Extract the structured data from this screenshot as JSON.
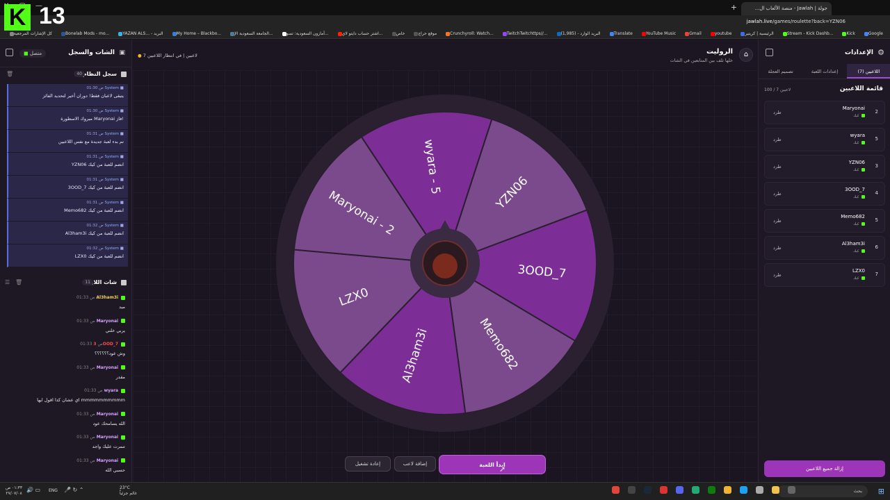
{
  "overlay": {
    "logo_letter": "K",
    "logo_number": "13"
  },
  "browser": {
    "tab_title": "جولة | Jawlah - منصة الألعاب ال...",
    "url_host": "jawlah.live",
    "url_path": "/games/roulette?back=YZN06",
    "bookmarks": [
      {
        "label": "Google",
        "color": "#4285f4"
      },
      {
        "label": "Kick",
        "color": "#53fc18"
      },
      {
        "label": "Stream - Kick Dashb...",
        "color": "#53fc18"
      },
      {
        "label": "الرئيسية | كريتير",
        "color": "#3a6ee8"
      },
      {
        "label": "youtube",
        "color": "#ff0000"
      },
      {
        "label": "Gmail",
        "color": "#ea4335"
      },
      {
        "label": "YouTube Music",
        "color": "#ff0000"
      },
      {
        "label": "Translate",
        "color": "#4285f4"
      },
      {
        "label": "البريد الوارد - (1,985)",
        "color": "#0f6cbd"
      },
      {
        "label": "TwitchTwitchttps//...",
        "color": "#9146ff"
      },
      {
        "label": "Crunchyroll: Watch...",
        "color": "#f47521"
      },
      {
        "label": "موقع حراج",
        "color": "#555555"
      },
      {
        "label": "خاص",
        "color": "#555555"
      },
      {
        "label": "اشتر حساب دايتو لاي...",
        "color": "#ff2200"
      },
      {
        "label": "أمازون السعودية: تسو...",
        "color": "#ffffff"
      },
      {
        "label": "الجامعة السعودية الإ...",
        "color": "#4a7d9e"
      },
      {
        "label": "My Home – Blackbo...",
        "color": "#3a7fd5"
      },
      {
        "label": "YAZAN ALS... - البريد",
        "color": "#3ab0e8"
      },
      {
        "label": "Bonelab Mods - mo...",
        "color": "#2a5599"
      },
      {
        "label": "كل الإشارات المرجعية",
        "color": "#888888"
      }
    ]
  },
  "left_panel": {
    "title": "الشات والسجل",
    "status": "متصل",
    "system_log": {
      "title": "سجل النظام",
      "count": "40",
      "items": [
        {
          "who": "System",
          "time": "01:30 ص",
          "text": "يتبقى لاعبان فقط! دوران أخير لتحديد الفائز"
        },
        {
          "who": "System",
          "time": "01:30 ص",
          "text": "مبروك الاسطورة Maryonai فاز!"
        },
        {
          "who": "System",
          "time": "01:31 ص",
          "text": "تم بدء لعبة جديدة مع نفس اللاعبين"
        },
        {
          "who": "System",
          "time": "01:31 ص",
          "text": "YZN06 انضم للعبة من كيك"
        },
        {
          "who": "System",
          "time": "01:31 ص",
          "text": "3OOD_7 انضم للعبة من كيك"
        },
        {
          "who": "System",
          "time": "01:31 ص",
          "text": "Memo682 انضم للعبة من كيك"
        },
        {
          "who": "System",
          "time": "01:32 ص",
          "text": "Al3ham3i انضم للعبة من كيك"
        },
        {
          "who": "System",
          "time": "01:32 ص",
          "text": "LZX0 انضم للعبة من كيك"
        }
      ]
    },
    "live_chat": {
      "title": "شات اللايف",
      "count": "11",
      "items": [
        {
          "name": "Al3ham3i",
          "time": "01:33 ص",
          "text": "مبد",
          "color": "#f2d15a"
        },
        {
          "name": "Maryonai",
          "time": "01:33 ص",
          "text": "يربي خلني",
          "color": "#d7a3ff"
        },
        {
          "name": "3OOD_7",
          "time": "01:33 ص",
          "text": "وش عود؟؟؟؟؟؟",
          "color": "#ff4a4a"
        },
        {
          "name": "Maryonai",
          "time": "01:33 ص",
          "text": "مقدر",
          "color": "#d7a3ff"
        },
        {
          "name": "wyara",
          "time": "01:33 ص",
          "text": "اي عشان كذا اقول ايها mmmmmmmmmm",
          "color": "#d7a3ff"
        },
        {
          "name": "Maryonai",
          "time": "01:33 ص",
          "text": "الله يسامحك عود",
          "color": "#d7a3ff"
        },
        {
          "name": "Maryonai",
          "time": "01:33 ص",
          "text": "تنمرت عليك واجد",
          "color": "#d7a3ff"
        },
        {
          "name": "Maryonai",
          "time": "01:33 ص",
          "text": "حسبي الله",
          "color": "#d7a3ff"
        }
      ]
    }
  },
  "center": {
    "title": "الروليت",
    "subtitle": "خلها تلف بين المتابعين في الشات",
    "waiting": "7 لاعبين  |  في انتظار اللاعبين",
    "wheel_segments": [
      {
        "label": "YZN06",
        "color": "#7a4a8c"
      },
      {
        "label": "3OOD_7",
        "color": "#7c2d96"
      },
      {
        "label": "Memo682",
        "color": "#7a4a8c"
      },
      {
        "label": "Al3ham3i",
        "color": "#7c2d96"
      },
      {
        "label": "LZX0",
        "color": "#7a4a8c"
      },
      {
        "label": "Maryonai - 2",
        "color": "#7a4a8c"
      },
      {
        "label": "wyara - 5",
        "color": "#7c2d96"
      }
    ],
    "buttons": {
      "start": "ابدأ اللعبة",
      "add_player": "إضافة لاعب",
      "restart": "إعادة تشغيل"
    }
  },
  "right_panel": {
    "title": "الإعدادات",
    "tabs": [
      {
        "label": "اللاعبين (7)",
        "active": true
      },
      {
        "label": "إعدادات اللعبة",
        "active": false
      },
      {
        "label": "تصميم العجلة",
        "active": false
      }
    ],
    "players_title": "قائمة اللاعبين",
    "players_count": "100 / 7 لاعبين",
    "kick_label": "طرد",
    "source_label": "كيك",
    "players": [
      {
        "name": "Maryonai",
        "rank": "2"
      },
      {
        "name": "wyara",
        "rank": "5"
      },
      {
        "name": "YZN06",
        "rank": "3"
      },
      {
        "name": "3OOD_7",
        "rank": "4"
      },
      {
        "name": "Memo682",
        "rank": "5"
      },
      {
        "name": "Al3ham3i",
        "rank": "6"
      },
      {
        "name": "LZX0",
        "rank": "7"
      }
    ],
    "remove_all": "إزالة جميع اللاعبين"
  },
  "taskbar": {
    "search": "بحث",
    "lang": "ENG",
    "time": "٠١:٣٣ ص",
    "date": "٢٧/٠٧/٠٨",
    "weather_temp": "23°C",
    "weather_desc": "غائم جزئياً"
  }
}
